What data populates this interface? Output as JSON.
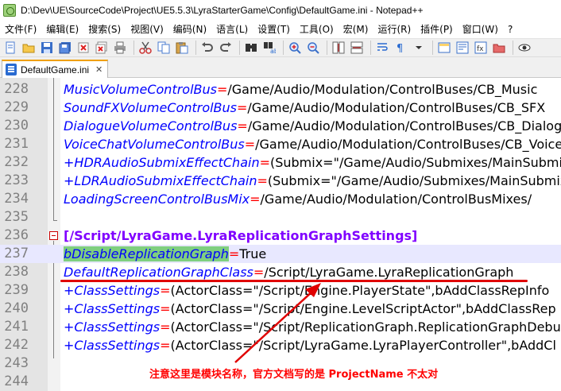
{
  "window": {
    "title": "D:\\Dev\\UE\\SourceCode\\Project\\UE5.5.3\\LyraStarterGame\\Config\\DefaultGame.ini - Notepad++"
  },
  "menu": [
    {
      "label": "文件(F)"
    },
    {
      "label": "编辑(E)"
    },
    {
      "label": "搜索(S)"
    },
    {
      "label": "视图(V)"
    },
    {
      "label": "编码(N)"
    },
    {
      "label": "语言(L)"
    },
    {
      "label": "设置(T)"
    },
    {
      "label": "工具(O)"
    },
    {
      "label": "宏(M)"
    },
    {
      "label": "运行(R)"
    },
    {
      "label": "插件(P)"
    },
    {
      "label": "窗口(W)"
    },
    {
      "label": "?"
    }
  ],
  "tab": {
    "label": "DefaultGame.ini",
    "close_glyph": "✕"
  },
  "colors": {
    "key": "#0000ff",
    "equals": "#ff0000",
    "section": "#8000ff",
    "highlight": "#7fcf7f",
    "annotation": "#ff0000"
  },
  "lines": [
    {
      "num": "228",
      "key": "MusicVolumeControlBus",
      "eq": "=",
      "val": "/Game/Audio/Modulation/ControlBuses/CB_Music"
    },
    {
      "num": "229",
      "key": "SoundFXVolumeControlBus",
      "eq": "=",
      "val": "/Game/Audio/Modulation/ControlBuses/CB_SFX"
    },
    {
      "num": "230",
      "key": "DialogueVolumeControlBus",
      "eq": "=",
      "val": "/Game/Audio/Modulation/ControlBuses/CB_Dialogue"
    },
    {
      "num": "231",
      "key": "VoiceChatVolumeControlBus",
      "eq": "=",
      "val": "/Game/Audio/Modulation/ControlBuses/CB_VoiceChat"
    },
    {
      "num": "232",
      "key": "+HDRAudioSubmixEffectChain",
      "eq": "=",
      "val": "(Submix=\"/Game/Audio/Submixes/MainSubmix"
    },
    {
      "num": "233",
      "key": "+LDRAudioSubmixEffectChain",
      "eq": "=",
      "val": "(Submix=\"/Game/Audio/Submixes/MainSubmix"
    },
    {
      "num": "234",
      "key": "LoadingScreenControlBusMix",
      "eq": "=",
      "val": "/Game/Audio/Modulation/ControlBusMixes/"
    },
    {
      "num": "235",
      "key": "",
      "eq": "",
      "val": ""
    },
    {
      "num": "236",
      "section": "[/Script/LyraGame.LyraReplicationGraphSettings]"
    },
    {
      "num": "237",
      "key": "bDisableReplicationGraph",
      "eq": "=",
      "val": "True"
    },
    {
      "num": "238",
      "key": "DefaultReplicationGraphClass",
      "eq": "=",
      "val": "/Script/LyraGame.LyraReplicationGraph"
    },
    {
      "num": "239",
      "key": "+ClassSettings",
      "eq": "=",
      "val": "(ActorClass=\"/Script/Engine.PlayerState\",bAddClassRepInfo"
    },
    {
      "num": "240",
      "key": "+ClassSettings",
      "eq": "=",
      "val": "(ActorClass=\"/Script/Engine.LevelScriptActor\",bAddClassRep"
    },
    {
      "num": "241",
      "key": "+ClassSettings",
      "eq": "=",
      "val": "(ActorClass=\"/Script/ReplicationGraph.ReplicationGraphDebug"
    },
    {
      "num": "242",
      "key": "+ClassSettings",
      "eq": "=",
      "val": "(ActorClass=\"/Script/LyraGame.LyraPlayerController\",bAddCl"
    },
    {
      "num": "243",
      "key": "",
      "eq": "",
      "val": ""
    },
    {
      "num": "244",
      "key": "",
      "eq": "",
      "val": ""
    }
  ],
  "annotation": {
    "text": "注意这里是模块名称，官方文档写的是 ProjectName 不太对"
  },
  "toolbar_icons": [
    "new-file-icon",
    "open-file-icon",
    "save-icon",
    "save-all-icon",
    "close-icon",
    "close-all-icon",
    "print-icon",
    "cut-icon",
    "copy-icon",
    "paste-icon",
    "undo-icon",
    "redo-icon",
    "find-icon",
    "replace-icon",
    "zoom-in-icon",
    "zoom-out-icon",
    "sync-vertical-icon",
    "sync-horizontal-icon",
    "word-wrap-icon",
    "show-all-chars-icon",
    "dropdown-icon",
    "indent-guide-icon",
    "doc-map-icon",
    "function-list-icon",
    "folder-workspace-icon",
    "monitoring-icon"
  ]
}
